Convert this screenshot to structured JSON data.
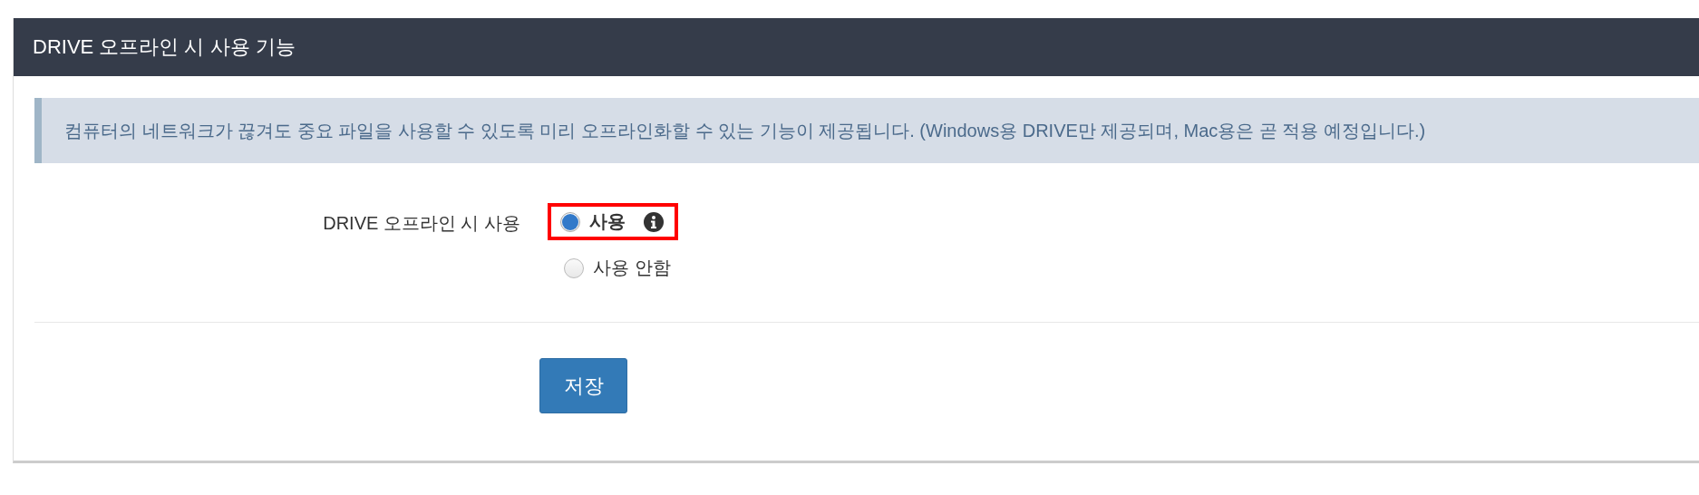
{
  "panel": {
    "title": "DRIVE 오프라인 시 사용 기능"
  },
  "notice": "컴퓨터의 네트워크가 끊겨도 중요 파일을 사용할 수 있도록 미리 오프라인화할 수 있는 기능이 제공됩니다. (Windows용 DRIVE만 제공되며, Mac용은 곧 적용 예정입니다.)",
  "setting": {
    "label": "DRIVE 오프라인 시 사용",
    "options": [
      {
        "label": "사용",
        "selected": true,
        "highlighted": true,
        "info": true
      },
      {
        "label": "사용 안함",
        "selected": false,
        "highlighted": false,
        "info": false
      }
    ]
  },
  "buttons": [
    {
      "label": "저장"
    }
  ]
}
